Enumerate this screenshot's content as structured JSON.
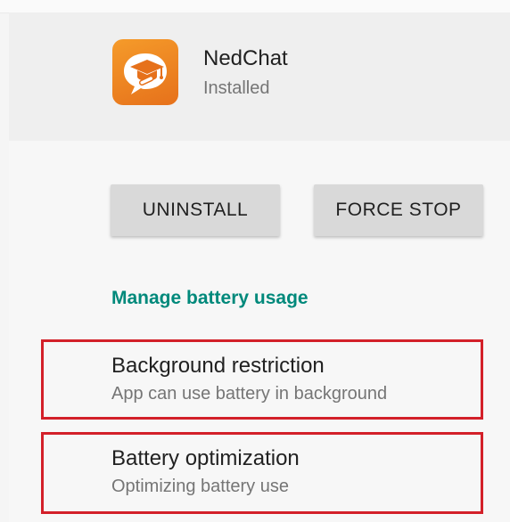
{
  "app": {
    "name": "NedChat",
    "status": "Installed",
    "icon": "nedchat-app-icon",
    "icon_color": "#F08A24"
  },
  "buttons": {
    "uninstall": "UNINSTALL",
    "force_stop": "FORCE STOP"
  },
  "battery": {
    "section_title": "Manage battery usage",
    "accent_color": "#00897B",
    "items": [
      {
        "title": "Background restriction",
        "summary": "App can use battery in background"
      },
      {
        "title": "Battery optimization",
        "summary": "Optimizing battery use"
      }
    ]
  },
  "highlight_color": "#D32029"
}
